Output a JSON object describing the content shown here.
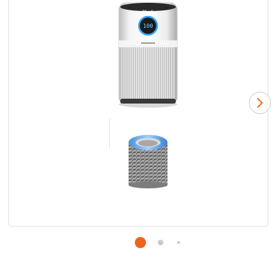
{
  "carousel": {
    "purifier": {
      "brand": "Shark",
      "display_value": "100"
    },
    "slide_count": 3,
    "active_slide": 1,
    "colors": {
      "active_dot": "#f16319",
      "inactive_dot": "#c9c9c9",
      "arrow": "#f16319"
    },
    "icons": {
      "next": "chevron-right-icon"
    }
  }
}
